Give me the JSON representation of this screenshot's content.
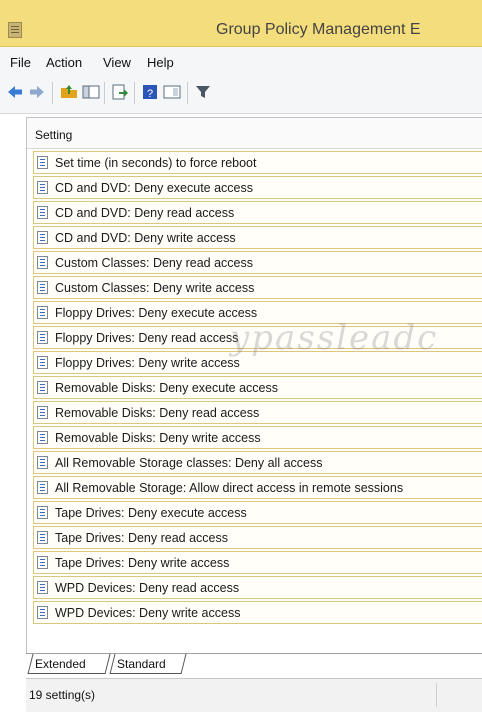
{
  "window": {
    "title": "Group Policy Management E",
    "icon": "gpo-document-icon"
  },
  "menu": {
    "items": [
      "File",
      "Action",
      "View",
      "Help"
    ]
  },
  "toolbar": {
    "buttons": [
      {
        "name": "back-icon",
        "color": "#3a7bd5"
      },
      {
        "name": "forward-icon",
        "color": "#3a7bd5"
      },
      {
        "name": "folder-up-icon",
        "color": "#e2a21a"
      },
      {
        "name": "show-hide-tree-icon",
        "color": "#5a6b7d"
      },
      {
        "name": "export-list-icon",
        "color": "#2f8a3a"
      },
      {
        "name": "help-icon",
        "color": "#2b55b8"
      },
      {
        "name": "properties-icon",
        "color": "#5a6b7d"
      },
      {
        "name": "filter-icon",
        "color": "#4a5566"
      }
    ]
  },
  "list": {
    "column_header": "Setting",
    "rows": [
      "Set time (in seconds) to force reboot",
      "CD and DVD: Deny execute access",
      "CD and DVD: Deny read access",
      "CD and DVD: Deny write access",
      "Custom Classes: Deny read access",
      "Custom Classes: Deny write access",
      "Floppy Drives: Deny execute access",
      "Floppy Drives: Deny read access",
      "Floppy Drives: Deny write access",
      "Removable Disks: Deny execute access",
      "Removable Disks: Deny read access",
      "Removable Disks: Deny write access",
      "All Removable Storage classes: Deny all access",
      "All Removable Storage: Allow direct access in remote sessions",
      "Tape Drives: Deny execute access",
      "Tape Drives: Deny read access",
      "Tape Drives: Deny write access",
      "WPD Devices: Deny read access",
      "WPD Devices: Deny write access"
    ]
  },
  "tabs": {
    "extended": "Extended",
    "standard": "Standard",
    "active": "Extended"
  },
  "status": {
    "text": "19 setting(s)"
  },
  "colors": {
    "titlebar": "#f4dd7c",
    "row_border": "#dcc77b"
  }
}
